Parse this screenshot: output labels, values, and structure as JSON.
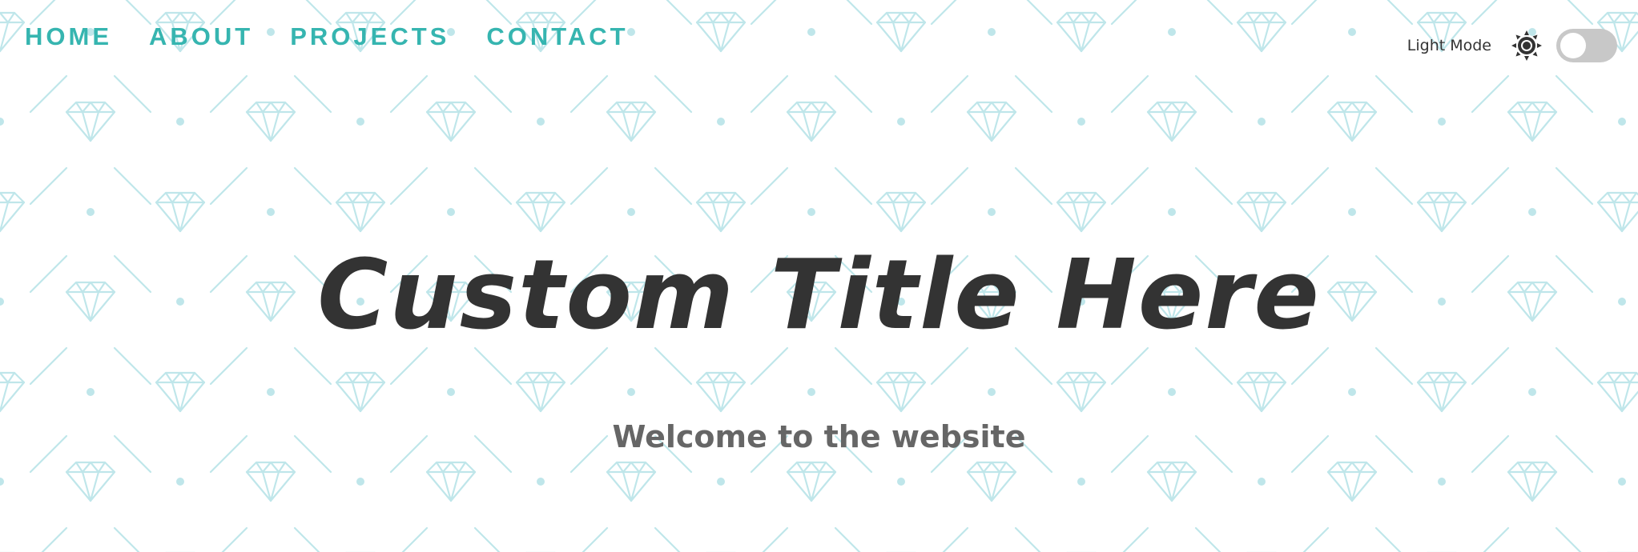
{
  "nav": {
    "items": [
      {
        "label": "HOME"
      },
      {
        "label": "ABOUT"
      },
      {
        "label": "PROJECTS"
      },
      {
        "label": "CONTACT"
      }
    ]
  },
  "mode_switch": {
    "label": "Light Mode",
    "icon": "sun-icon",
    "enabled": false
  },
  "hero": {
    "title": "Custom Title Here",
    "subtitle": "Welcome to the website"
  },
  "colors": {
    "accent": "#36b5b0",
    "pattern": "#bfe6ea",
    "title": "#333333",
    "subtitle": "#666666",
    "toggle_track": "#c8c8c8"
  }
}
